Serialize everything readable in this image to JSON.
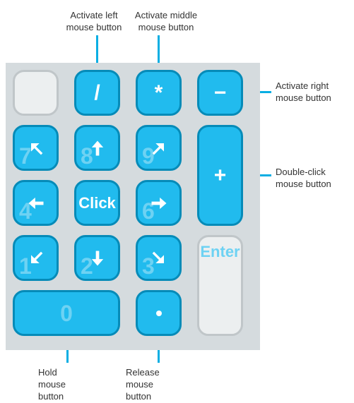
{
  "labels": {
    "activate_left": "Activate left mouse button",
    "activate_middle": "Activate middle mouse button",
    "activate_right": "Activate right mouse button",
    "double_click": "Double-click mouse button",
    "hold": "Hold mouse button",
    "release": "Release mouse button"
  },
  "keys": {
    "slash": "/",
    "asterisk": "*",
    "minus": "−",
    "plus": "+",
    "click": "Click",
    "enter": "Enter",
    "zero": "0",
    "dot": "·",
    "n7": "7",
    "n8": "8",
    "n9": "9",
    "n4": "4",
    "n6": "6",
    "n1": "1",
    "n2": "2",
    "n3": "3"
  },
  "colors": {
    "key_fill": "#21bbee",
    "key_border": "#068bb8",
    "pad_bg": "#d5dbde",
    "ghost": "#6ed2f3"
  }
}
